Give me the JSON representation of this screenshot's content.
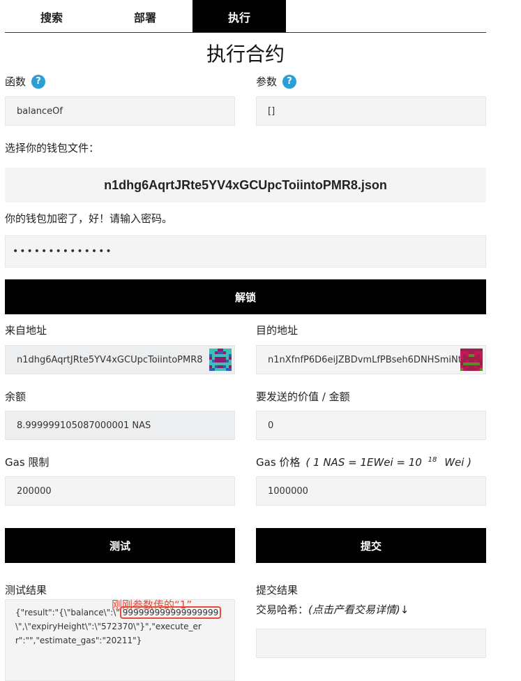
{
  "tabs": [
    {
      "label": "搜索"
    },
    {
      "label": "部署"
    },
    {
      "label": "执行"
    }
  ],
  "page_title": "执行合约",
  "function": {
    "label": "函数",
    "value": "balanceOf"
  },
  "params": {
    "label": "参数",
    "value": "[]"
  },
  "help_glyph": "?",
  "wallet": {
    "select_label": "选择你的钱包文件：",
    "file_name": "n1dhg6AqrtJRte5YV4xGCUpcToiintoPMR8.json",
    "encrypted_msg": "你的钱包加密了，好！请输入密码。",
    "password_mask": "••••••••••••••",
    "unlock_label": "解锁"
  },
  "from": {
    "label": "来自地址",
    "value": "n1dhg6AqrtJRte5YV4xGCUpcToiintoPMR8"
  },
  "to": {
    "label": "目的地址",
    "value": "n1nXfnfP6D6eiJZBDvmLfPBseh6DNHSmiNt"
  },
  "balance": {
    "label": "余额",
    "value": "8.999999105087000001 NAS"
  },
  "amount": {
    "label": "要发送的价值 / 金额",
    "value": "0"
  },
  "gas_limit": {
    "label": "Gas 限制",
    "value": "200000"
  },
  "gas_price": {
    "label": "Gas 价格",
    "hint_prefix": "( 1 NAS = 1EWei = 10",
    "hint_exp": "18",
    "hint_suffix": "Wei )",
    "value": "1000000"
  },
  "test_button": "测试",
  "submit_button": "提交",
  "test_result": {
    "label": "测试结果",
    "text_before": "{\"result\":\"{\\\"balance\\\":\\\"",
    "highlight": "999999999999999999",
    "text_after": "\\\",\\\"expiryHeight\\\":\\\"572370\\\"}\",\"execute_err\":\"\",\"estimate_gas\":\"20211\"}",
    "annotation": "刚刚参数传的“1”"
  },
  "submit_result": {
    "label": "提交结果",
    "tx_hash_label": "交易哈希：",
    "tx_hash_hint": "(点击产看交易详情)↓"
  },
  "colors": {
    "accent": "#000000",
    "help": "#2a9fd6",
    "annotation": "#e44b3b"
  }
}
